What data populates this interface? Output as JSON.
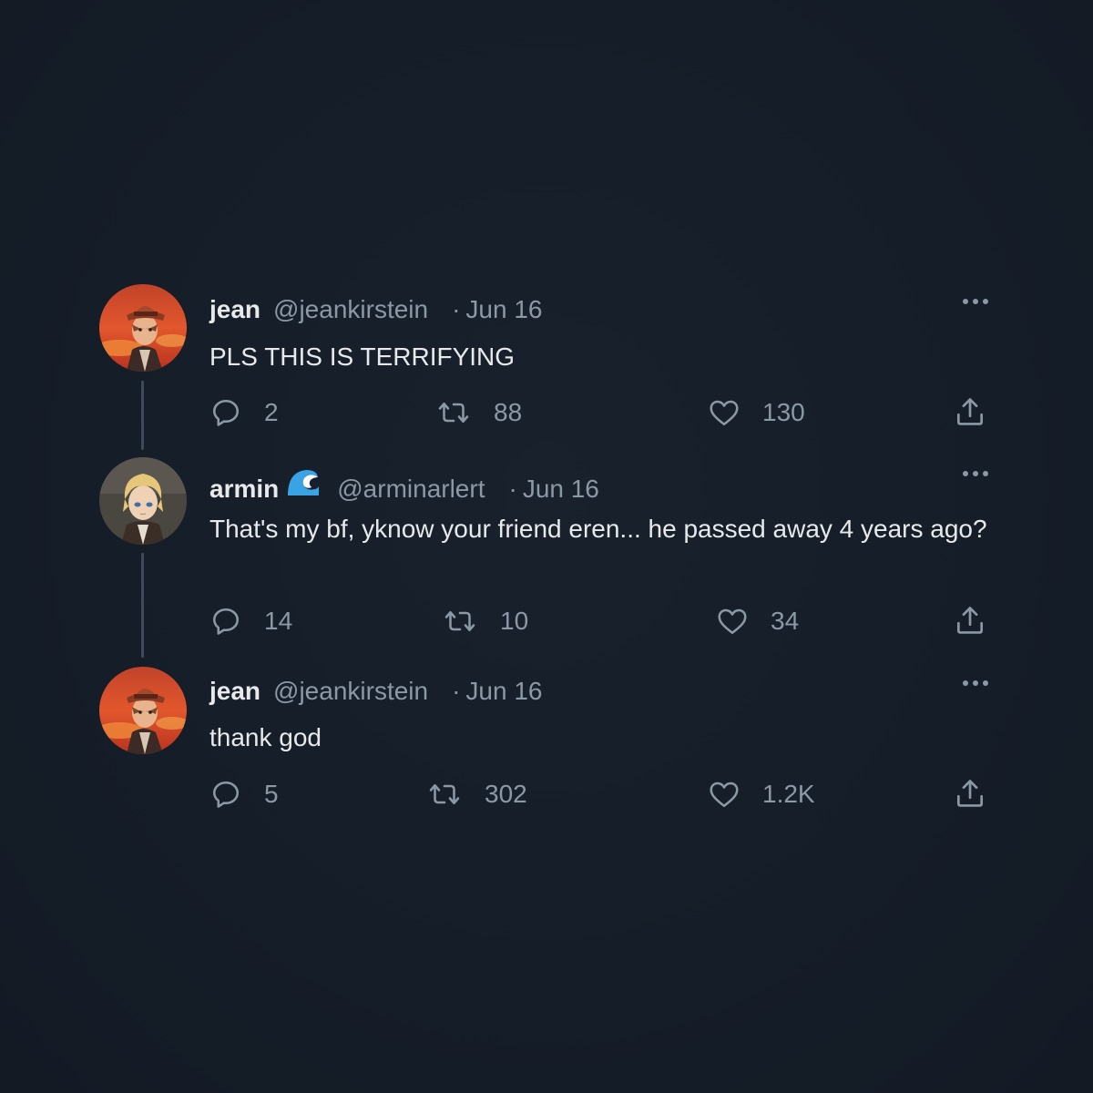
{
  "thread": {
    "tweets": [
      {
        "name": "jean",
        "handle": "@jeankirstein",
        "separator": "·",
        "date": "Jun 16",
        "text": "PLS THIS IS TERRIFYING",
        "replies": "2",
        "retweets": "88",
        "likes": "130"
      },
      {
        "name": "armin",
        "name_emoji": "water-wave-icon",
        "handle": "@arminarlert",
        "separator": "·",
        "date": "Jun 16",
        "text": "That's my bf, yknow your friend eren... he passed away 4 years ago?",
        "replies": "14",
        "retweets": "10",
        "likes": "34"
      },
      {
        "name": "jean",
        "handle": "@jeankirstein",
        "separator": "·",
        "date": "Jun 16",
        "text": "thank god",
        "replies": "5",
        "retweets": "302",
        "likes": "1.2K"
      }
    ]
  },
  "colors": {
    "background": "#151d28",
    "primary_text": "#e7e9ea",
    "secondary_text": "#8b98a5",
    "thread_line": "#3d4a59"
  }
}
